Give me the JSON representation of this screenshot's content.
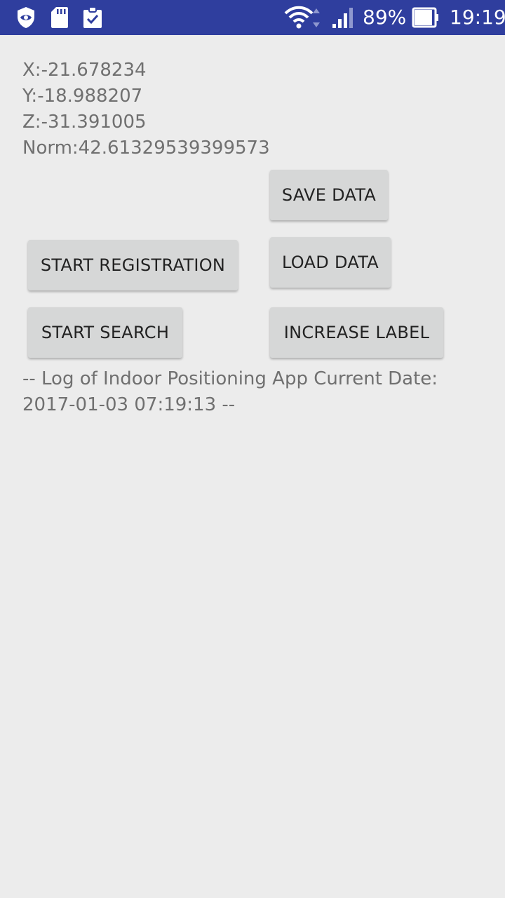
{
  "status_bar": {
    "battery_percent": "89%",
    "time": "19:19",
    "background_color": "#2f3e9e",
    "left_icons": [
      "shield-eye-icon",
      "sd-card-icon",
      "clipboard-check-icon"
    ],
    "right_icons": [
      "wifi-icon",
      "signal-icon",
      "battery-icon"
    ]
  },
  "sensor": {
    "x": "X:-21.678234",
    "y": "Y:-18.988207",
    "z": "Z:-31.391005",
    "norm": "Norm:42.61329539399573"
  },
  "buttons": {
    "save_data": "SAVE DATA",
    "start_registration": "START REGISTRATION",
    "load_data": "LOAD DATA",
    "start_search": "START SEARCH",
    "increase_label": "INCREASE LABEL"
  },
  "log": {
    "text": "-- Log of Indoor Positioning App Current Date: 2017-01-03 07:19:13 --"
  }
}
